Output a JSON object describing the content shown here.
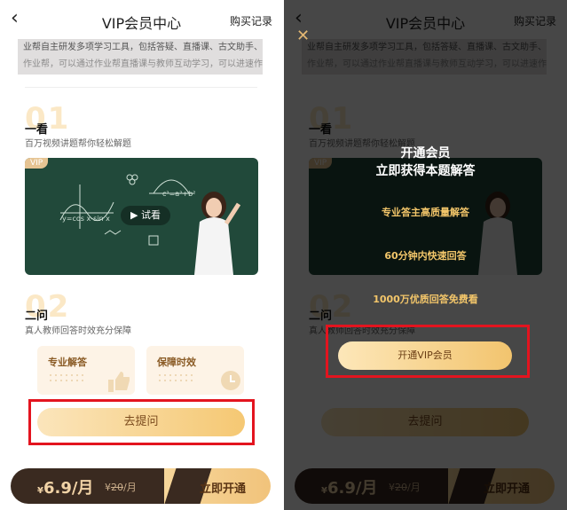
{
  "header": {
    "back_icon": "chevron-left-icon",
    "title": "VIP会员中心",
    "records": "购买记录"
  },
  "intro": {
    "line1": "业帮自主研发多项学习工具，包括答疑、直播课、古文助手、",
    "line2": "作业帮，可以通过作业帮直播课与教师互动学习，可以进速作"
  },
  "step1": {
    "num": "01",
    "title": "一看",
    "subtitle": "百万视频讲题帮你轻松解题"
  },
  "video": {
    "badge": "VIP",
    "play_label": "试看",
    "formula1": "y=cos x-sin x",
    "formula2": "c²=a²+b²",
    "formula3": "(a, b)"
  },
  "step2": {
    "num": "02",
    "title": "二问",
    "subtitle": "真人教师回答时效充分保障"
  },
  "cards": [
    {
      "label": "专业解答"
    },
    {
      "label": "保障时效"
    }
  ],
  "ask_button": "去提问",
  "bottom_bar": {
    "currency": "¥",
    "price": "6.9",
    "unit": "/月",
    "old_currency": "¥",
    "old_price": "20",
    "old_unit": "/月",
    "buy_label": "立即开通"
  },
  "popup": {
    "close_icon": "close-icon",
    "title1": "开通会员",
    "title2": "立即获得本题解答",
    "features": [
      "专业答主高质量解答",
      "60分钟内快速回答",
      "1000万优质回答免费看"
    ],
    "cta": "开通VIP会员"
  },
  "colors": {
    "accent": "#f5c873",
    "highlight_border": "#e3141f",
    "dark": "#3a2a20"
  }
}
